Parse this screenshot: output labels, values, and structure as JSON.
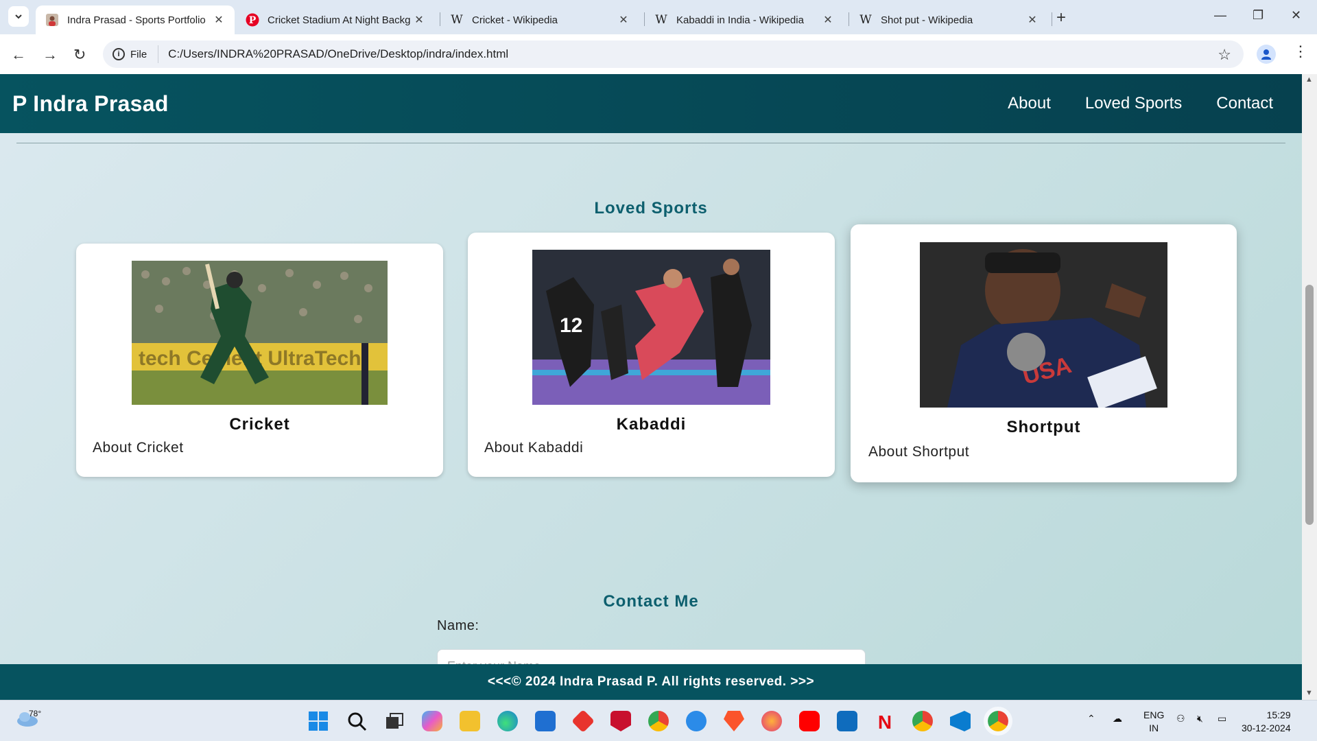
{
  "browser": {
    "tabs": [
      {
        "title": "Indra Prasad - Sports Portfolio",
        "active": true,
        "icon": "person-favicon"
      },
      {
        "title": "Cricket Stadium At Night Backg",
        "active": false,
        "icon": "pinterest-icon"
      },
      {
        "title": "Cricket - Wikipedia",
        "active": false,
        "icon": "wikipedia-icon"
      },
      {
        "title": "Kabaddi in India - Wikipedia",
        "active": false,
        "icon": "wikipedia-icon"
      },
      {
        "title": "Shot put - Wikipedia",
        "active": false,
        "icon": "wikipedia-icon"
      }
    ],
    "chip_label": "File",
    "url": "C:/Users/INDRA%20PRASAD/OneDrive/Desktop/indra/index.html"
  },
  "site": {
    "title": "P Indra Prasad",
    "nav": [
      {
        "label": "About"
      },
      {
        "label": "Loved Sports"
      },
      {
        "label": "Contact"
      }
    ],
    "sports_heading": "Loved Sports",
    "cards": [
      {
        "title": "Cricket",
        "desc": "About Cricket"
      },
      {
        "title": "Kabaddi",
        "desc": "About Kabaddi"
      },
      {
        "title": "Shortput",
        "desc": "About Shortput"
      }
    ],
    "contact_heading": "Contact Me",
    "name_label": "Name:",
    "name_placeholder": "Enter your Name",
    "footer": "<<<© 2024 Indra Prasad P. All rights reserved. >>>"
  },
  "taskbar": {
    "weather_temp": "78°",
    "lang_line1": "ENG",
    "lang_line2": "IN",
    "time": "15:29",
    "date": "30-12-2024"
  },
  "colors": {
    "header_bg": "#06535f",
    "heading_text": "#0d5f6e",
    "page_bg_gradient": "#b9d9d9"
  }
}
